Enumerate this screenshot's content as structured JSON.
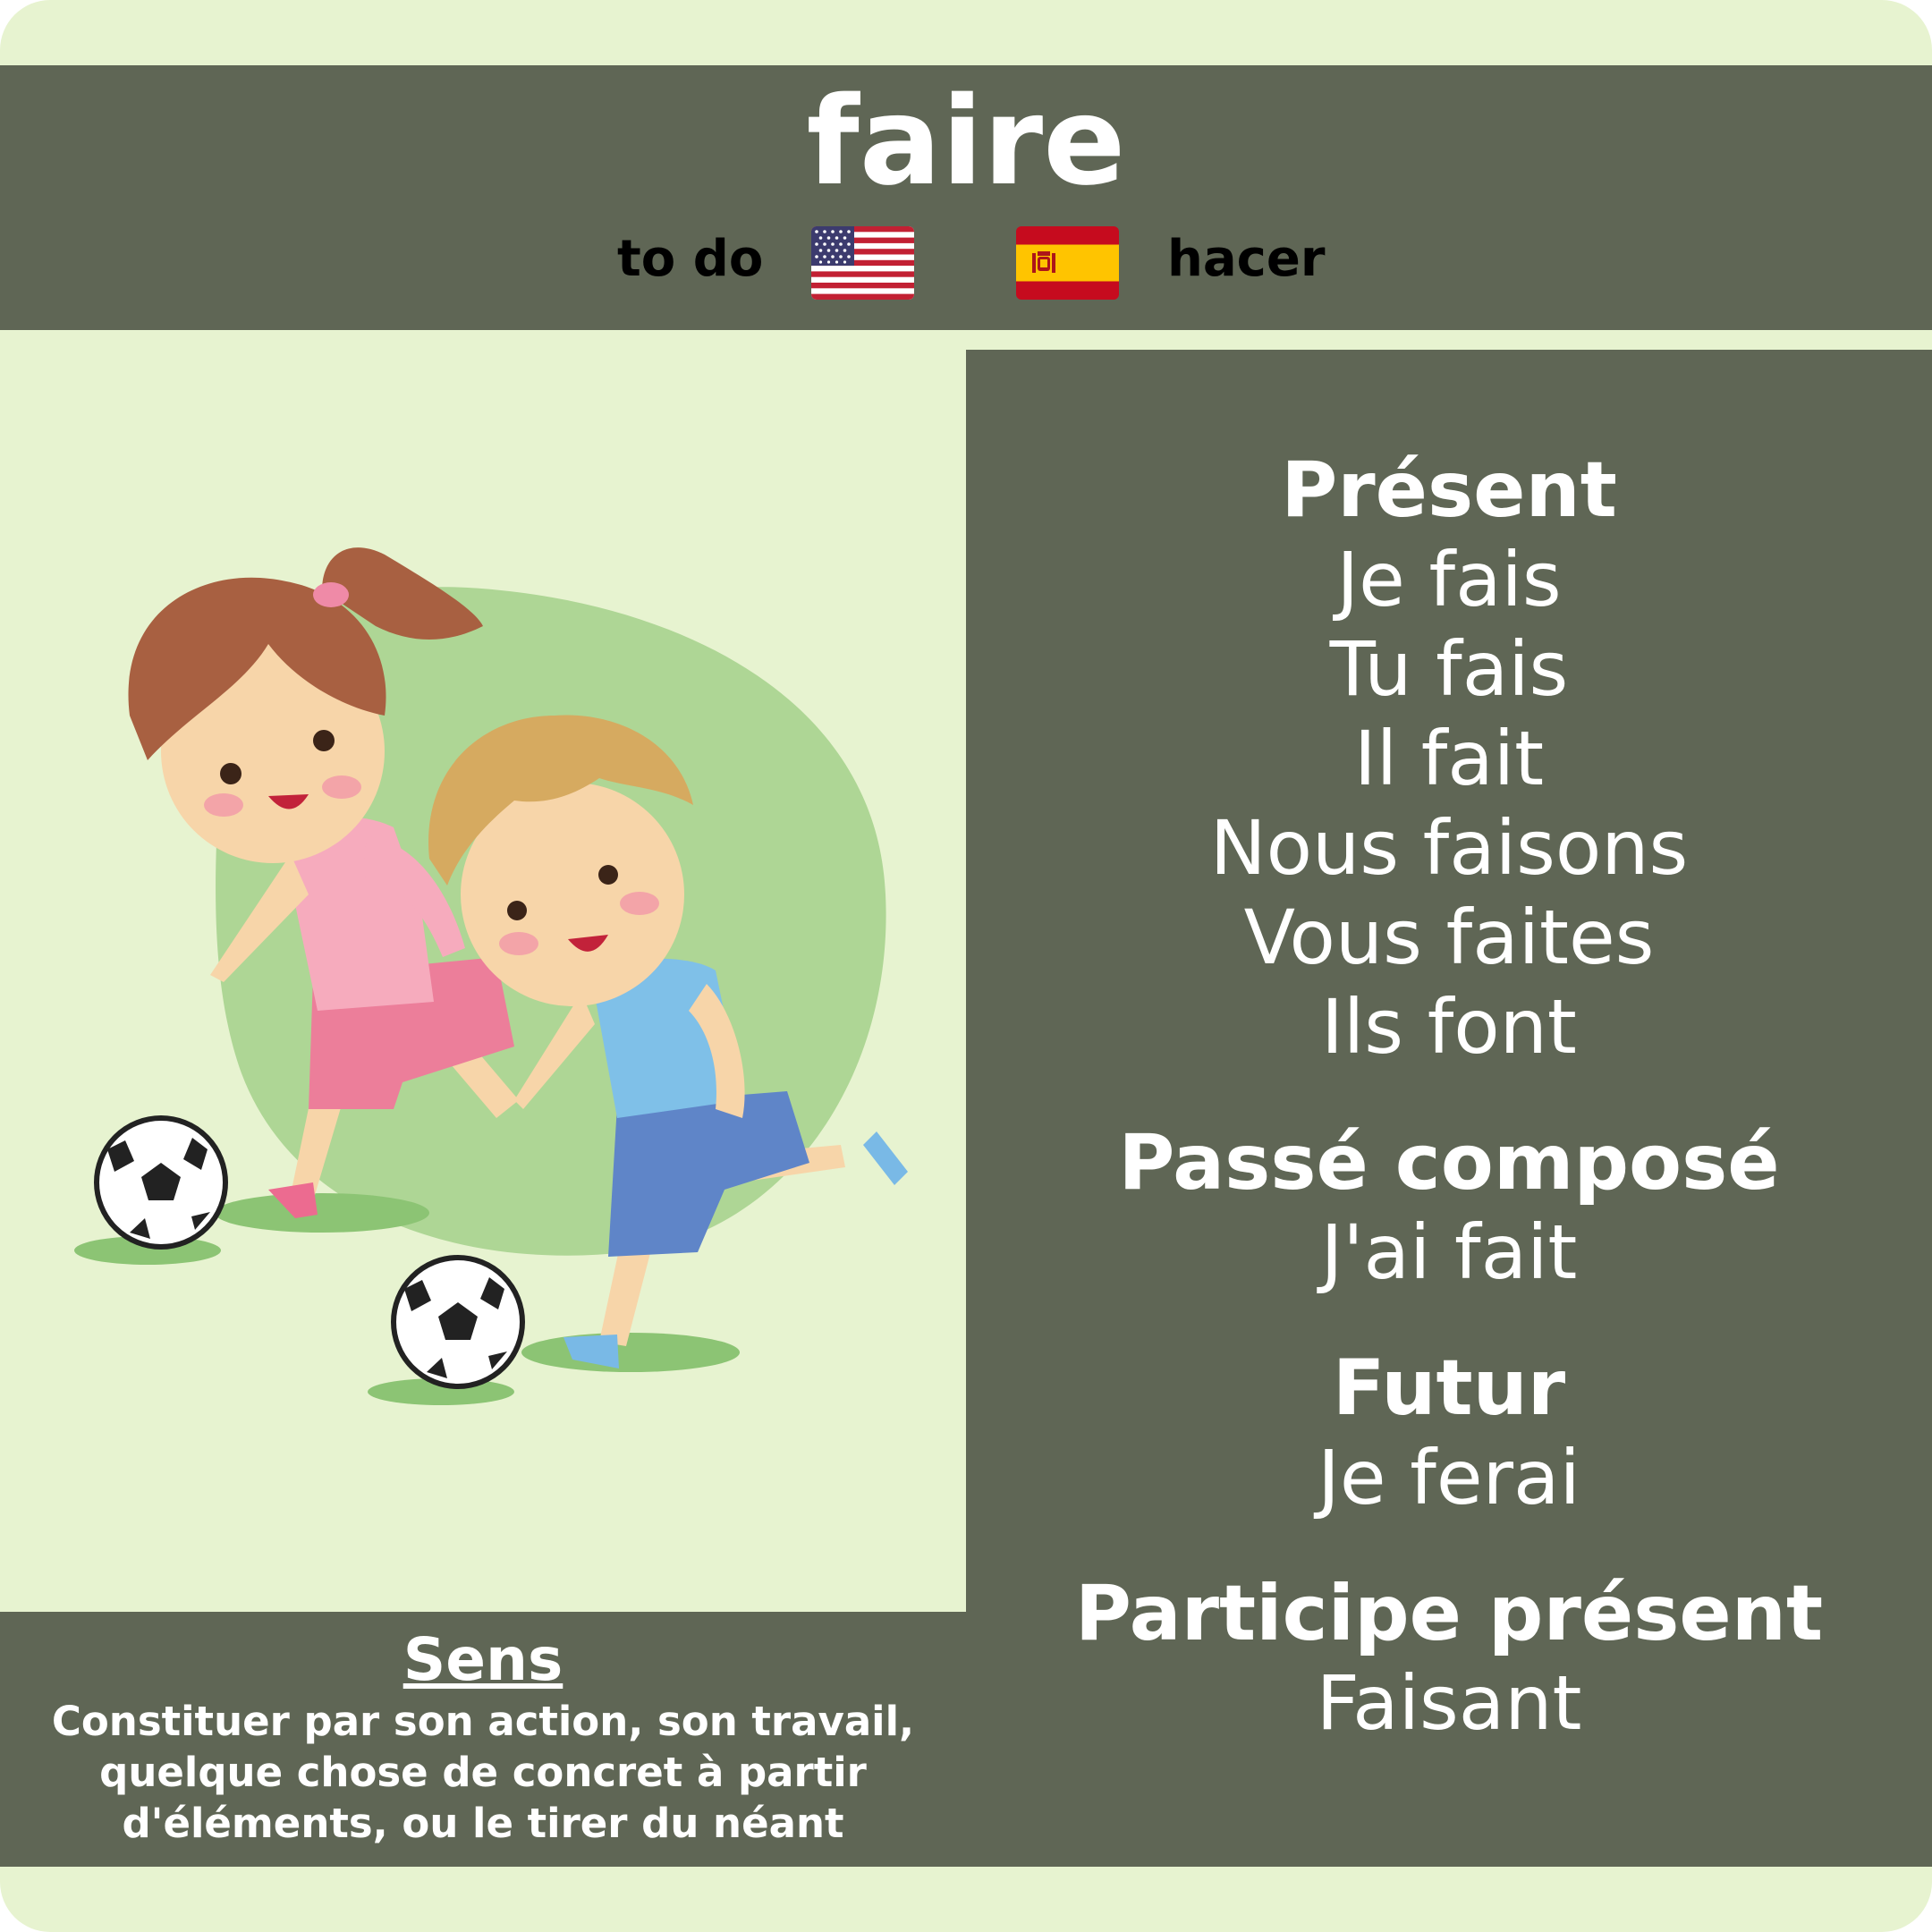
{
  "verb": "faire",
  "translations": {
    "english": "to do",
    "spanish": "hacer",
    "english_flag_icon": "us-flag-icon",
    "spanish_flag_icon": "spain-flag-icon"
  },
  "illustration": "children-playing-soccer",
  "conjugations": {
    "present": {
      "title": "Présent",
      "forms": [
        "Je fais",
        "Tu fais",
        "Il fait",
        "Nous faisons",
        "Vous faites",
        "Ils font"
      ]
    },
    "passe_compose": {
      "title": "Passé composé",
      "form": "J'ai fait"
    },
    "futur": {
      "title": "Futur",
      "form": "Je ferai"
    },
    "participe_present": {
      "title": "Participe présent",
      "form": "Faisant"
    }
  },
  "meaning": {
    "title": "Sens",
    "lines": [
      "Constituer par son action, son travail,",
      "quelque chose de concret à partir",
      "d'éléments, ou le tirer du néant"
    ]
  },
  "colors": {
    "background": "#e7f3d0",
    "panel": "#5f6655",
    "text": "#ffffff"
  }
}
